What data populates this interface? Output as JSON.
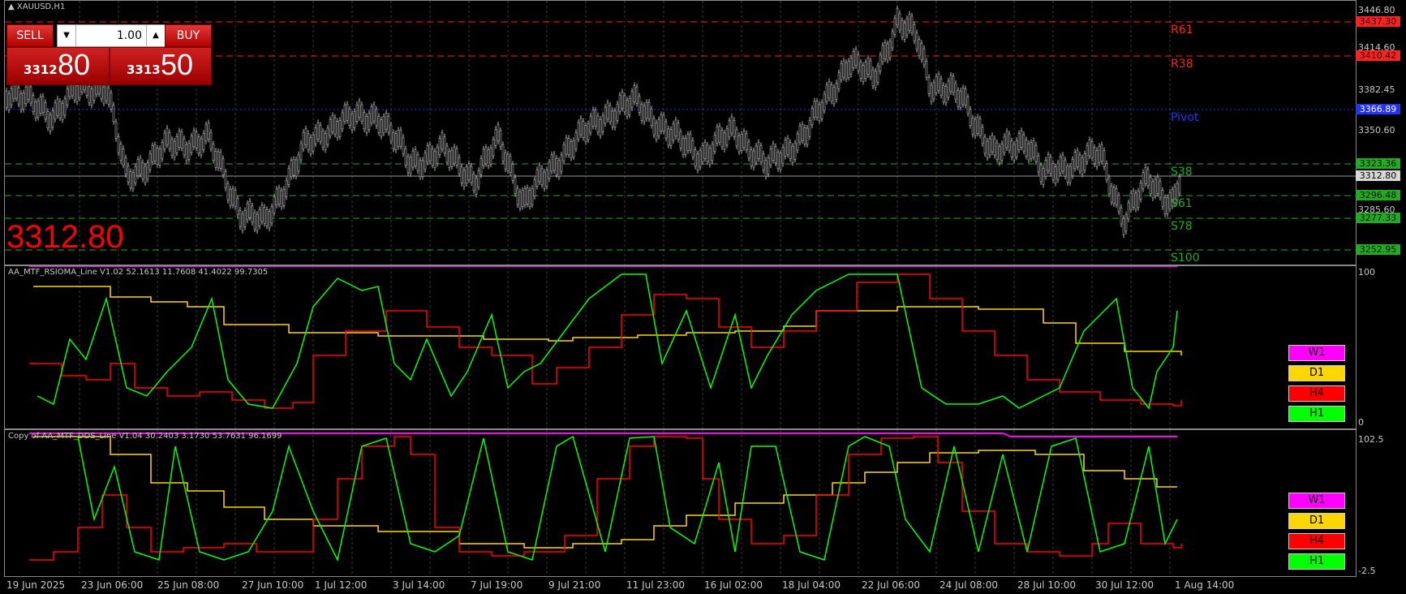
{
  "symbol_title": "XAUUSD,H1",
  "trade_panel": {
    "sell_label": "SELL",
    "buy_label": "BUY",
    "lot": "1.00",
    "bid_big": "3312",
    "bid_small": "80",
    "ask_big": "3313",
    "ask_small": "50",
    "lot_down_icon": "triangle-down",
    "lot_up_icon": "triangle-up"
  },
  "current_price": "3312.80",
  "levels": [
    {
      "name": "R61",
      "price": "3437.30",
      "color": "#ff2020",
      "kind": "resistance"
    },
    {
      "name": "R38",
      "price": "3410.42",
      "color": "#ff2020",
      "kind": "resistance"
    },
    {
      "name": "Pivot",
      "price": "3366.89",
      "color": "#2233ff",
      "kind": "pivot"
    },
    {
      "name": "S38",
      "price": "3323.36",
      "color": "#22aa22",
      "kind": "support"
    },
    {
      "name": "S61",
      "price": "3296.48",
      "color": "#22aa22",
      "kind": "support"
    },
    {
      "name": "S78",
      "price": "3277.33",
      "color": "#22aa22",
      "kind": "support"
    },
    {
      "name": "S100",
      "price": "3252.95",
      "color": "#22aa22",
      "kind": "support"
    }
  ],
  "current_price_tag": "3312.80",
  "price_axis": [
    "3446.80",
    "3414.60",
    "3382.45",
    "3350.60",
    "3285.60"
  ],
  "rsi_pane": {
    "title": "AA_MTF_RSIOMA_Line V1.02 52.1613 11.7608 41.4022 99.7305",
    "axis_top": "100",
    "axis_bottom": "0",
    "legend": [
      {
        "label": "W1",
        "color": "#ff00ff"
      },
      {
        "label": "D1",
        "color": "#ffd700"
      },
      {
        "label": "H4",
        "color": "#ff0000"
      },
      {
        "label": "H1",
        "color": "#00ff00"
      }
    ]
  },
  "dds_pane": {
    "title": "Copy of AA_MTF_DDS_Line V1.04 30.2403 3.1730 53.7631 96.1699",
    "axis_top": "102.5",
    "axis_bottom": "-2.5",
    "legend": [
      {
        "label": "W1",
        "color": "#ff00ff"
      },
      {
        "label": "D1",
        "color": "#ffd700"
      },
      {
        "label": "H4",
        "color": "#ff0000"
      },
      {
        "label": "H1",
        "color": "#00ff00"
      }
    ]
  },
  "dates": [
    "19 Jun 2025",
    "23 Jun 06:00",
    "25 Jun 08:00",
    "27 Jun 10:00",
    "1 Jul 12:00",
    "3 Jul 14:00",
    "7 Jul 19:00",
    "9 Jul 21:00",
    "11 Jul 23:00",
    "16 Jul 02:00",
    "18 Jul 04:00",
    "22 Jul 06:00",
    "24 Jul 08:00",
    "28 Jul 10:00",
    "30 Jul 12:00",
    "1 Aug 14:00"
  ],
  "colors": {
    "candle": "#b4b4b4",
    "grid": "#3a3a3a",
    "bullish": "#b4b4b4",
    "bearish": "#b4b4b4"
  }
}
